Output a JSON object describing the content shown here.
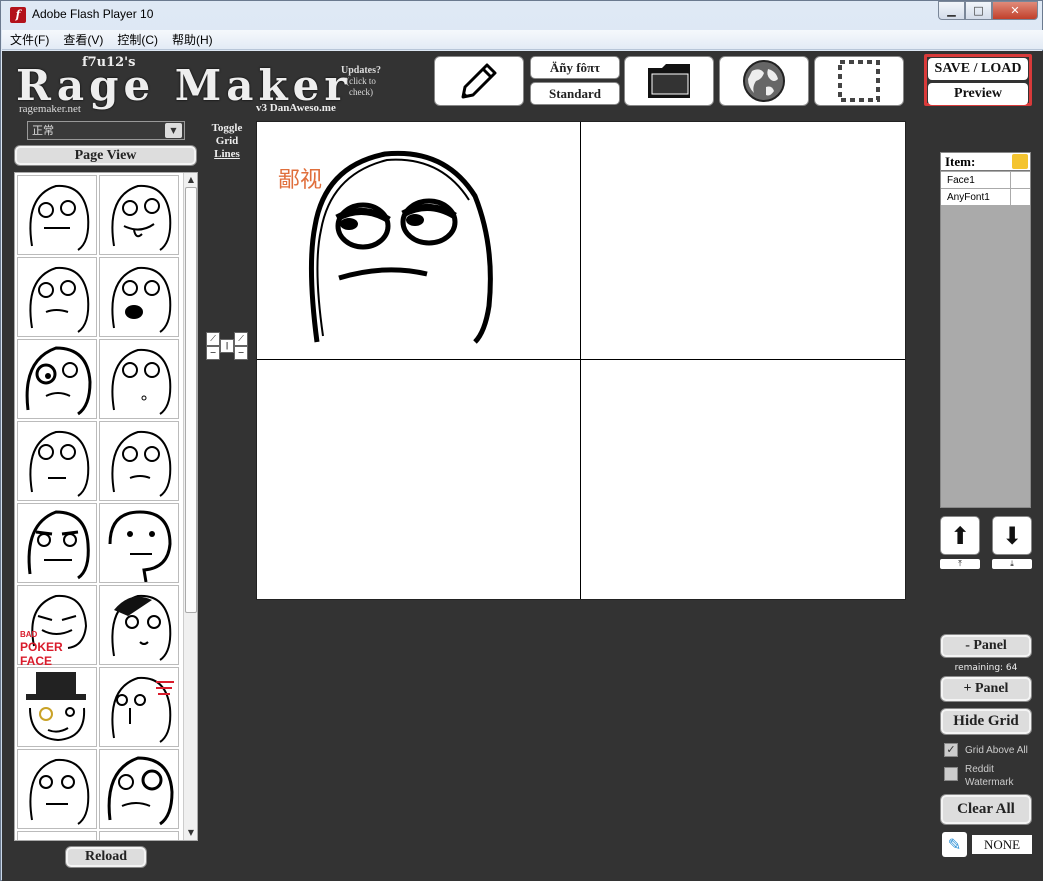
{
  "window": {
    "title": "Adobe Flash Player 10",
    "buttons": {
      "minimize": "▁",
      "maximize": "□",
      "close": "✕"
    }
  },
  "menu": [
    "文件(F)",
    "查看(V)",
    "控制(C)",
    "帮助(H)"
  ],
  "logo": {
    "small": "f7u12's",
    "big": "Rage Maker",
    "url": "ragemaker.net"
  },
  "updates": {
    "line1": "Updates?",
    "line2": "(click to",
    "line3": "check)"
  },
  "version": "v3  DanAweso.me",
  "toolbar": {
    "font_fancy": "Äñy fôπτ",
    "font_standard": "Standard",
    "icons": [
      "pencil-icon",
      "folder-icon",
      "globe-icon",
      "selection-icon"
    ]
  },
  "save": {
    "save_load": "SAVE / LOAD",
    "preview": "Preview"
  },
  "left": {
    "blend_mode": "正常",
    "page_view": "Page View",
    "reload": "Reload",
    "face_labels": {
      "poker_face": "POKER FACE",
      "bad": "BAD"
    }
  },
  "grid_toggle": {
    "line1": "Toggle",
    "line2": "Grid",
    "line3": "Lines"
  },
  "canvas": {
    "text_item": "鄙视"
  },
  "items": {
    "header": "Item:",
    "rows": [
      {
        "label": "Face1"
      },
      {
        "label": "AnyFont1"
      }
    ]
  },
  "right": {
    "minus_panel": "- Panel",
    "remaining": "remaining:  64",
    "plus_panel": "+ Panel",
    "hide_grid": "Hide Grid",
    "grid_above_all": "Grid Above All",
    "reddit_watermark_1": "Reddit",
    "reddit_watermark_2": "Watermark",
    "clear_all": "Clear All",
    "color_value": "NONE"
  },
  "colors": {
    "stage_bg": "#333333",
    "accent_red": "#d93a3a",
    "canvas_text": "#e06f3c"
  }
}
